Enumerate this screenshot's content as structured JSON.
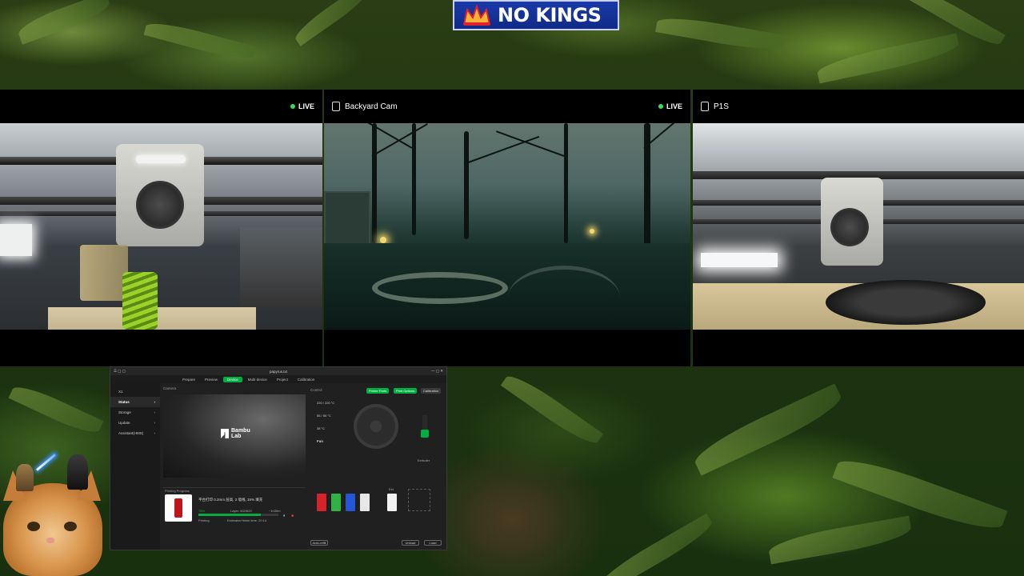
{
  "banner": {
    "text": "NO KINGS"
  },
  "cameras": [
    {
      "title": "",
      "live": "LIVE",
      "icon": "camera-icon"
    },
    {
      "title": "Backyard Cam",
      "live": "LIVE",
      "icon": "camera-icon"
    },
    {
      "title": "P1S",
      "live": "",
      "icon": "camera-icon"
    }
  ],
  "studio": {
    "title": "papyrus.txt",
    "tabs": [
      "Prepare",
      "Preview",
      "Device",
      "Multi-device",
      "Project",
      "Calibration"
    ],
    "active_tab": "Device",
    "device": "X1",
    "sidebar": [
      "Status",
      "Storage",
      "Update",
      "Assistant(HMS)"
    ],
    "camera_label": "Camera",
    "logo": "Bambu Lab",
    "job_label": "Printing Progress",
    "job_name": "平台打印 0.2mm 层高, 2 墙线, 15% 填充",
    "layer": "Layer: 602/620",
    "time_left": "~1h36m",
    "status": "Printing",
    "progress_pct": 78,
    "progress_text": "78%",
    "estimated": "Estimated finish time: 20:14",
    "control_label": "Control",
    "print_parts": "Printer Parts",
    "print_options": "Print Options",
    "calibration": "Calibration",
    "nozzle_temp": "220 / 220 °C",
    "bed_temp": "55 / 55 °C",
    "chamber_temp": "38 °C",
    "fan_label": "Fan",
    "ext_label": "Ext",
    "extruder_label": "Extruder",
    "auto_refill": "Auto-refill",
    "unload": "Unload",
    "load": "Load",
    "spool_colors": [
      "#d6232a",
      "#2fb342",
      "#2456d6",
      "#e8e8e8"
    ],
    "accent": "#00ae42"
  }
}
